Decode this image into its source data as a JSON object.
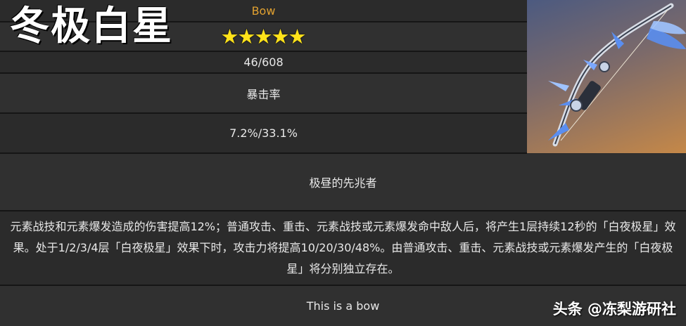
{
  "title": "冬极白星",
  "weapon": {
    "type": "Bow",
    "rarity_stars": 5,
    "base_atk": "46/608",
    "substat_name": "暴击率",
    "substat_value": "7.2%/33.1%",
    "passive_name": "极昼的先兆者",
    "passive_desc": "元素战技和元素爆发造成的伤害提高12%；普通攻击、重击、元素战技或元素爆发命中敌人后，将产生1层持续12秒的「白夜极星」效果。处于1/2/3/4层「白夜极星」效果下时，攻击力将提高10/20/30/48%。由普通攻击、重击、元素战技或元素爆发产生的「白夜极星」将分别独立存在。",
    "lore": "This is a bow"
  },
  "watermark": "头条 @冻梨游研社",
  "icons": {
    "star": "star-icon"
  },
  "colors": {
    "type_text": "#e0a030",
    "star": "#ffe21a"
  }
}
